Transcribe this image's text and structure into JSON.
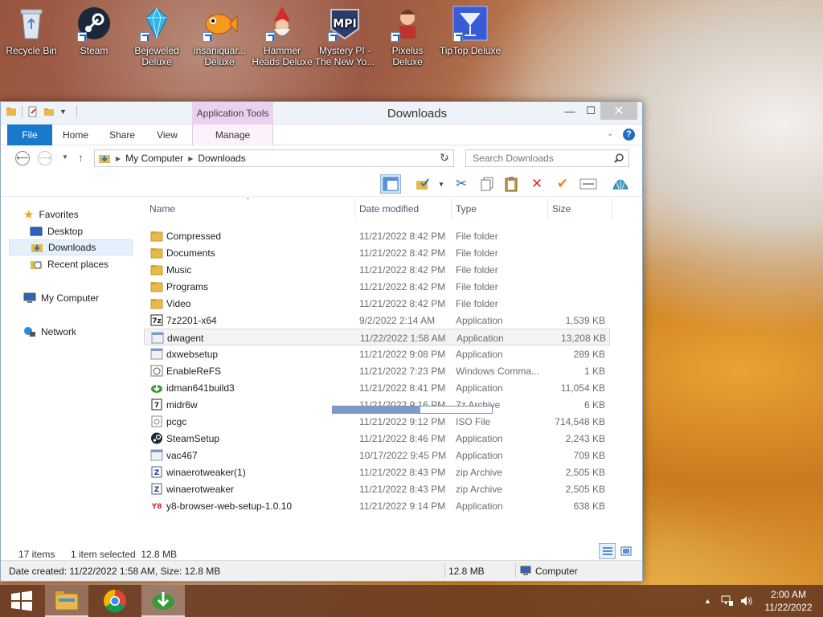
{
  "desktop_icons": [
    {
      "name": "recycle-bin-icon",
      "label": "Recycle Bin"
    },
    {
      "name": "steam-icon",
      "label": "Steam"
    },
    {
      "name": "bejeweled-icon",
      "label": "Bejeweled Deluxe"
    },
    {
      "name": "insaniquarium-icon",
      "label": "Insaniquar... Deluxe"
    },
    {
      "name": "hammer-heads-icon",
      "label": "Hammer Heads Deluxe"
    },
    {
      "name": "mystery-pi-icon",
      "label": "Mystery PI - The New Yo..."
    },
    {
      "name": "pixelus-icon",
      "label": "Pixelus Deluxe"
    },
    {
      "name": "tiptop-icon",
      "label": "TipTop Deluxe"
    }
  ],
  "window": {
    "title": "Downloads",
    "context_tab": "Application Tools",
    "tabs": {
      "file": "File",
      "home": "Home",
      "share": "Share",
      "view": "View",
      "manage": "Manage"
    },
    "help": "?",
    "minimize": "—",
    "maximize": "☐",
    "close": "✕"
  },
  "address": {
    "breadcrumb": [
      "My Computer",
      "Downloads"
    ],
    "search_placeholder": "Search Downloads"
  },
  "columns": {
    "name": "Name",
    "date": "Date modified",
    "type": "Type",
    "size": "Size"
  },
  "nav": {
    "favorites": "Favorites",
    "desktop": "Desktop",
    "downloads": "Downloads",
    "recent": "Recent places",
    "computer": "My Computer",
    "network": "Network"
  },
  "files": [
    {
      "name": "Compressed",
      "date": "11/21/2022 8:42 PM",
      "type": "File folder",
      "size": "",
      "icon": "folder-icon"
    },
    {
      "name": "Documents",
      "date": "11/21/2022 8:42 PM",
      "type": "File folder",
      "size": "",
      "icon": "folder-icon"
    },
    {
      "name": "Music",
      "date": "11/21/2022 8:42 PM",
      "type": "File folder",
      "size": "",
      "icon": "folder-icon"
    },
    {
      "name": "Programs",
      "date": "11/21/2022 8:42 PM",
      "type": "File folder",
      "size": "",
      "icon": "folder-icon"
    },
    {
      "name": "Video",
      "date": "11/21/2022 8:42 PM",
      "type": "File folder",
      "size": "",
      "icon": "folder-icon"
    },
    {
      "name": "7z2201-x64",
      "date": "9/2/2022 2:14 AM",
      "type": "Application",
      "size": "1,539 KB",
      "icon": "7zip-icon"
    },
    {
      "name": "dwagent",
      "date": "11/22/2022 1:58 AM",
      "type": "Application",
      "size": "13,208 KB",
      "icon": "app-icon"
    },
    {
      "name": "dxwebsetup",
      "date": "11/21/2022 9:08 PM",
      "type": "Application",
      "size": "289 KB",
      "icon": "app-icon"
    },
    {
      "name": "EnableReFS",
      "date": "11/21/2022 7:23 PM",
      "type": "Windows Comma...",
      "size": "1 KB",
      "icon": "cmd-icon"
    },
    {
      "name": "idman641build3",
      "date": "11/21/2022 8:41 PM",
      "type": "Application",
      "size": "11,054 KB",
      "icon": "idm-icon"
    },
    {
      "name": "midr6w",
      "date": "11/21/2022 9:16 PM",
      "type": "7z Archive",
      "size": "6 KB",
      "icon": "archive-icon"
    },
    {
      "name": "pcgc",
      "date": "11/21/2022 9:12 PM",
      "type": "ISO File",
      "size": "714,548 KB",
      "icon": "iso-icon"
    },
    {
      "name": "SteamSetup",
      "date": "11/21/2022 8:46 PM",
      "type": "Application",
      "size": "2,243 KB",
      "icon": "steam-icon"
    },
    {
      "name": "vac467",
      "date": "10/17/2022 9:45 PM",
      "type": "Application",
      "size": "709 KB",
      "icon": "app-icon"
    },
    {
      "name": "winaerotweaker(1)",
      "date": "11/21/2022 8:43 PM",
      "type": "zip Archive",
      "size": "2,505 KB",
      "icon": "zip-icon"
    },
    {
      "name": "winaerotweaker",
      "date": "11/21/2022 8:43 PM",
      "type": "zip Archive",
      "size": "2,505 KB",
      "icon": "zip-icon"
    },
    {
      "name": "y8-browser-web-setup-1.0.10",
      "date": "11/21/2022 9:14 PM",
      "type": "Application",
      "size": "638 KB",
      "icon": "y8-icon"
    }
  ],
  "status": {
    "count": "17 items",
    "selected": "1 item selected  12.8 MB",
    "detail": "Date created: 11/22/2022 1:58 AM, Size: 12.8 MB",
    "detail_size": "12.8 MB",
    "location": "Computer"
  },
  "progress": {
    "fraction": 0.55
  },
  "clock": {
    "time": "2:00 AM",
    "date": "11/22/2022"
  },
  "colors": {
    "accent": "#1979ca",
    "context_tab": "#ead2ee",
    "folder": "#e8b94a"
  }
}
